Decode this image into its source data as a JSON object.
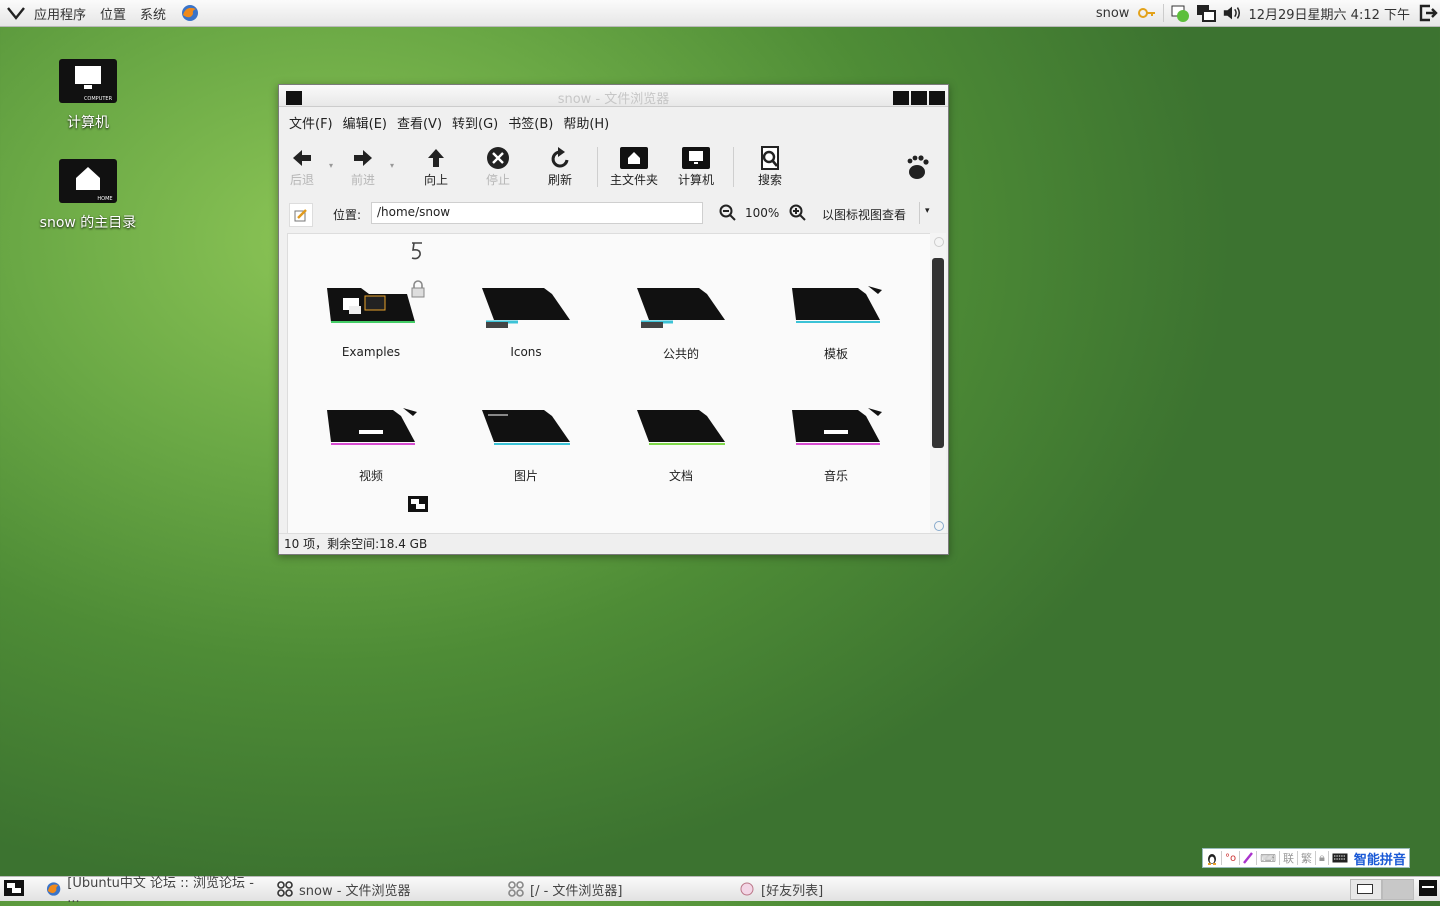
{
  "topbar": {
    "menu": [
      "应用程序",
      "位置",
      "系统"
    ],
    "user": "snow",
    "datetime": "12月29日星期六 4:12 下午"
  },
  "desktop": {
    "icons": [
      {
        "label": "计算机",
        "badge": "COMPUTER"
      },
      {
        "label": "snow 的主目录",
        "badge": "HOME"
      }
    ]
  },
  "window": {
    "title": "snow - 文件浏览器",
    "menubar": [
      "文件(F)",
      "编辑(E)",
      "查看(V)",
      "转到(G)",
      "书签(B)",
      "帮助(H)"
    ],
    "toolbar": {
      "back": "后退",
      "forward": "前进",
      "up": "向上",
      "stop": "停止",
      "reload": "刷新",
      "home": "主文件夹",
      "computer": "计算机",
      "search": "搜索"
    },
    "location": {
      "label": "位置:",
      "value": "/home/snow",
      "zoom": "100%",
      "view_mode": "以图标视图查看"
    },
    "items": [
      "Examples",
      "Icons",
      "公共的",
      "模板",
      "视频",
      "图片",
      "文档",
      "音乐"
    ],
    "status": "10 项，剩余空间:18.4 GB"
  },
  "taskbar": {
    "tasks": [
      "[Ubuntu中文 论坛 :: 浏览论坛 - ...",
      "snow - 文件浏览器",
      "[/ - 文件浏览器]",
      "[好友列表]"
    ]
  },
  "ime": {
    "items": [
      "联",
      "繁"
    ],
    "brand": "智能拼音"
  }
}
